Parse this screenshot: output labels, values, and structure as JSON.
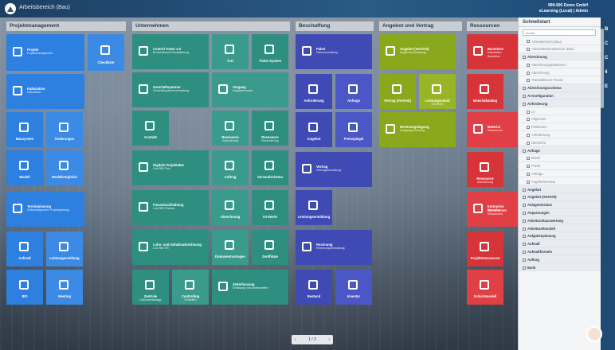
{
  "header": {
    "app_title": "Arbeitsbereich (Bau)",
    "company": "999-900 Demo GmbH",
    "user": "eLearning (Local) | Admin"
  },
  "sections": {
    "projekt": "Projektmanagement",
    "unternehmen": "Unternehmen",
    "beschaffung": "Beschaffung",
    "angebot": "Angebot und Vertrag",
    "ressourcen": "Ressourcen"
  },
  "tiles": {
    "pm": {
      "t1": "Projekt",
      "t2": "Projektmanagement"
    },
    "checkliste": {
      "t1": "Checkliste",
      "t2": ""
    },
    "kalkulation": {
      "t1": "Kalkulation",
      "t2": "Kalkulation"
    },
    "bausystem": {
      "t1": "Bausystem",
      "t2": ""
    },
    "aenderungen": {
      "t1": "Änderungen",
      "t2": ""
    },
    "modell": {
      "t1": "Modell",
      "t2": ""
    },
    "modellvergleich": {
      "t1": "Modellvergleich",
      "t2": ""
    },
    "termin": {
      "t1": "Terminplanung",
      "t2": "Zeitmanagement, Projektplanung"
    },
    "aufmass": {
      "t1": "Aufmaß",
      "t2": ""
    },
    "leistungsmeldung": {
      "t1": "Leistungsmeldung",
      "t2": ""
    },
    "bfi": {
      "t1": "BFI",
      "t2": ""
    },
    "meeting": {
      "t1": "Meeting",
      "t2": ""
    },
    "control": {
      "t1": "Control Tower 4.0",
      "t2": "BI Dashboard Visualisierung"
    },
    "tlk": {
      "t1": "TLK",
      "t2": ""
    },
    "ticket": {
      "t1": "Ticket System",
      "t2": ""
    },
    "geschaeft": {
      "t1": "Geschäftspartner",
      "t2": "Geschäftspartnerverwaltung"
    },
    "vorgang": {
      "t1": "Vorgang",
      "t2": "Aufgabenmodul"
    },
    "kontakt": {
      "t1": "Kontakt",
      "t2": ""
    },
    "ressanf": {
      "t1": "Ressource",
      "t2": "Anforderung"
    },
    "ressres": {
      "t1": "Ressource",
      "t2": "Reservierung"
    },
    "digital": {
      "t1": "Digitale Projektakte",
      "t2": "Link RIB iTwo"
    },
    "auftrag": {
      "t1": "Auftrag",
      "t2": ""
    },
    "versand": {
      "t1": "Versandschema",
      "t2": ""
    },
    "finanz": {
      "t1": "Finanzbuchhaltung",
      "t2": "Link RIB Finance"
    },
    "abrechnung": {
      "t1": "Abrechnung",
      "t2": ""
    },
    "istwerte": {
      "t1": "Ist-Werte",
      "t2": ""
    },
    "lohn": {
      "t1": "Lohn- und Gehaltsabrechnung",
      "t2": "Link RIB HR"
    },
    "dokvorlage": {
      "t1": "Dokumentvorlagen",
      "t2": ""
    },
    "zertifikate": {
      "t1": "Zertifikate",
      "t2": ""
    },
    "zentral": {
      "t1": "Zentrale",
      "t2": "Dokumentablage"
    },
    "controlling": {
      "t1": "Controlling",
      "t2": "Einheiten"
    },
    "zeiterfassung": {
      "t1": "Zeiterfassung",
      "t2": "Erfassung von Arbeitszeiten"
    },
    "paket": {
      "t1": "Paket",
      "t2": "Paketverwaltung"
    },
    "anforderung": {
      "t1": "Anforderung",
      "t2": ""
    },
    "anfrage": {
      "t1": "Anfrage",
      "t2": ""
    },
    "angebot_b": {
      "t1": "Angebot",
      "t2": ""
    },
    "preisspiegel": {
      "t1": "Preisspiegel",
      "t2": ""
    },
    "vertrag": {
      "t1": "Vertrag",
      "t2": "Vertragsverwaltung"
    },
    "leistungsermittlung": {
      "t1": "Leistungsermittlung",
      "t2": ""
    },
    "rechnung": {
      "t1": "Rechnung",
      "t2": "Rechnungsverwaltung"
    },
    "bestand": {
      "t1": "Bestand",
      "t2": ""
    },
    "inventar": {
      "t1": "Inventar",
      "t2": ""
    },
    "angebot_v": {
      "t1": "Angebot (Vertrieb)",
      "t2": "Angebotsverwaltung"
    },
    "vertrag_v": {
      "t1": "Vertrag (Vertrieb)",
      "t2": ""
    },
    "leistungsstand": {
      "t1": "Leistungsstand",
      "t2": "(Vertrieb)"
    },
    "rechnungslegung": {
      "t1": "Rechnungslegung",
      "t2": "Ausgangsrechnung"
    },
    "bausteine": {
      "t1": "Bausteine",
      "t2": "Kalkulation Bausteine"
    },
    "materialkatalog": {
      "t1": "Materialkatalog",
      "t2": ""
    },
    "material": {
      "t1": "Material",
      "t2": "Ressourcen"
    },
    "ressanf2": {
      "t1": "Ressource",
      "t2": "Anforderung"
    },
    "enterprise": {
      "t1": "Enterprise Ressourcen",
      "t2": "Enterprise Ressourcen"
    },
    "projektressourcen": {
      "t1": "Projektressourcen",
      "t2": ""
    },
    "schichtmodell": {
      "t1": "Schichtmodell",
      "t2": ""
    }
  },
  "pager": {
    "prev": "‹",
    "label": "1 / 2",
    "next": "›"
  },
  "panel": {
    "title": "Schnellstart",
    "search_placeholder": "Suche",
    "items": [
      {
        "label": "Arbeitsbereich (Bau)",
        "type": "sub"
      },
      {
        "label": "Administrationsbereich (Bau)",
        "type": "sub"
      },
      {
        "label": "Abrechnung",
        "type": "grp"
      },
      {
        "label": "Abrechnungspositionen",
        "type": "sub"
      },
      {
        "label": "Abrechnung",
        "type": "sub"
      },
      {
        "label": "Transaktionen Finanz",
        "type": "sub"
      },
      {
        "label": "Abrechnungsschema",
        "type": "grp"
      },
      {
        "label": "AI Konfiguration",
        "type": "grp"
      },
      {
        "label": "Anforderung",
        "type": "grp"
      },
      {
        "label": "LV",
        "type": "sub"
      },
      {
        "label": "Allgemein",
        "type": "sub"
      },
      {
        "label": "Positionen",
        "type": "sub"
      },
      {
        "label": "Anforderung",
        "type": "sub"
      },
      {
        "label": "Übersicht",
        "type": "sub"
      },
      {
        "label": "Anfrage",
        "type": "grp"
      },
      {
        "label": "Detail",
        "type": "sub"
      },
      {
        "label": "Portal",
        "type": "sub"
      },
      {
        "label": "Anfrage",
        "type": "sub"
      },
      {
        "label": "Angebotsreview",
        "type": "sub"
      },
      {
        "label": "Angebot",
        "type": "grp"
      },
      {
        "label": "Angebot (Vertrieb)",
        "type": "grp"
      },
      {
        "label": "Anlageninstanz",
        "type": "grp"
      },
      {
        "label": "Anpassungen",
        "type": "grp"
      },
      {
        "label": "Arbeitszeitauswertung",
        "type": "grp"
      },
      {
        "label": "Arbeitszeitmodell",
        "type": "grp"
      },
      {
        "label": "Aufgabenplanung",
        "type": "grp"
      },
      {
        "label": "Aufmaß",
        "type": "grp"
      },
      {
        "label": "Aufmaßformeln",
        "type": "grp"
      },
      {
        "label": "Auftrag",
        "type": "grp"
      },
      {
        "label": "Bank",
        "type": "grp"
      }
    ]
  },
  "rightstrip": [
    "B",
    "C",
    "C",
    "4",
    "E"
  ]
}
